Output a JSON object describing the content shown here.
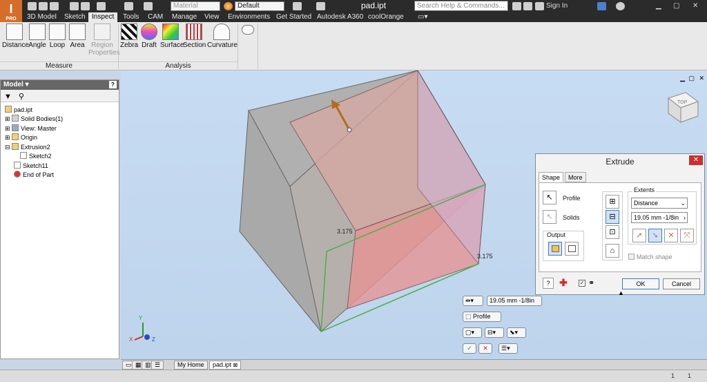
{
  "app": {
    "badge": "I",
    "badge_sub": "PRO",
    "doc_title": "pad.ipt"
  },
  "quick_access": {
    "material_placeholder": "Material",
    "appearance_value": "Default",
    "search_placeholder": "Search Help & Commands...",
    "sign_in": "Sign In"
  },
  "tabs": [
    "3D Model",
    "Sketch",
    "Inspect",
    "Tools",
    "CAM",
    "Manage",
    "View",
    "Environments",
    "Get Started",
    "Autodesk A360",
    "coolOrange"
  ],
  "active_tab": "Inspect",
  "ribbon": {
    "measure": {
      "title": "Measure",
      "buttons": [
        "Distance",
        "Angle",
        "Loop",
        "Area",
        "Region Properties"
      ]
    },
    "analysis": {
      "title": "Analysis",
      "buttons": [
        "Zebra",
        "Draft",
        "Surface",
        "Section",
        "Curvature"
      ]
    }
  },
  "browser": {
    "title": "Model",
    "items": [
      "pad.ipt",
      "Solid Bodies(1)",
      "View: Master",
      "Origin",
      "Extrusion2",
      "Sketch2",
      "Sketch11",
      "End of Part"
    ]
  },
  "viewport": {
    "dim_label_1": "3.175",
    "dim_label_2": "3.175",
    "viewcube_face": "TOP"
  },
  "extrude_dialog": {
    "title": "Extrude",
    "tab_shape": "Shape",
    "tab_more": "More",
    "profile_label": "Profile",
    "solids_label": "Solids",
    "output_label": "Output",
    "extents_label": "Extents",
    "extents_type": "Distance",
    "distance_value": "19.05 mm -1/8in",
    "match_shape_label": "Match shape",
    "ok_label": "OK",
    "cancel_label": "Cancel"
  },
  "mini_toolbar": {
    "distance_value": "19.05 mm -1/8in",
    "profile_label": "Profile"
  },
  "doc_tabs": {
    "home": "My Home",
    "doc": "pad.ipt"
  },
  "status": {
    "left": "",
    "num1": "1",
    "num2": "1"
  }
}
